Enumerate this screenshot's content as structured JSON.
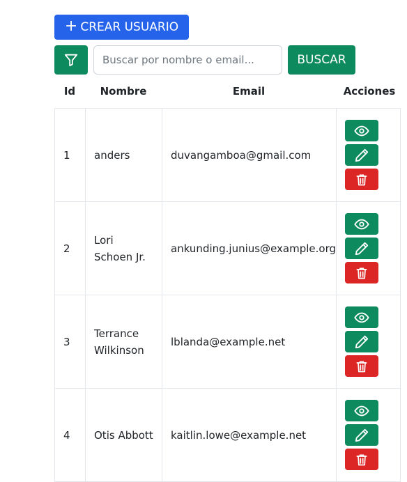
{
  "toolbar": {
    "create_plus": "+",
    "create_label": "CREAR USUARIO",
    "search_placeholder": "Buscar por nombre o email...",
    "search_label": "BUSCAR"
  },
  "table": {
    "headers": {
      "id": "Id",
      "name": "Nombre",
      "email": "Email",
      "actions": "Acciones"
    },
    "rows": [
      {
        "id": "1",
        "name": "anders",
        "email": "duvangamboa@gmail.com"
      },
      {
        "id": "2",
        "name": "Lori Schoen Jr.",
        "email": "ankunding.junius@example.org"
      },
      {
        "id": "3",
        "name": "Terrance Wilkinson",
        "email": "lblanda@example.net"
      },
      {
        "id": "4",
        "name": "Otis Abbott",
        "email": "kaitlin.lowe@example.net"
      }
    ]
  },
  "icons": {
    "create": "plus-icon",
    "filter": "filter-icon",
    "view": "eye-icon",
    "edit": "pencil-icon",
    "delete": "trash-icon"
  },
  "colors": {
    "primary": "#2563eb",
    "success": "#0e8a5f",
    "danger": "#dc2626"
  }
}
